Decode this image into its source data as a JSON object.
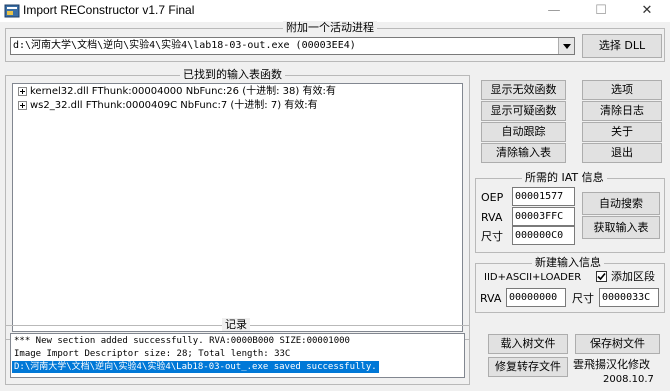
{
  "window": {
    "title": "Import REConstructor v1.7 Final",
    "minimize_glyph": "—",
    "maximize_glyph": "☐",
    "close_glyph": "✕"
  },
  "process": {
    "group_title": "附加一个活动进程",
    "selected": "d:\\河南大学\\文档\\逆向\\实验4\\实验4\\lab18-03-out.exe (00003EE4)",
    "select_dll_label": "选择 DLL"
  },
  "imports": {
    "group_title": "已找到的输入表函数",
    "rows": [
      "kernel32.dll FThunk:00004000 NbFunc:26 (十进制: 38) 有效:有",
      "ws2_32.dll FThunk:0000409C NbFunc:7 (十进制: 7) 有效:有"
    ]
  },
  "actions": {
    "show_invalid": "显示无效函数",
    "show_suspect": "显示可疑函数",
    "auto_trace": "自动跟踪",
    "clear_imports": "清除输入表",
    "options": "选项",
    "clear_log": "清除日志",
    "about": "关于",
    "exit": "退出"
  },
  "iat": {
    "group_title": "所需的 IAT 信息",
    "oep_label": "OEP",
    "oep_value": "00001577",
    "rva_label": "RVA",
    "rva_value": "00003FFC",
    "size_label": "尺寸",
    "size_value": "000000C0",
    "auto_search": "自动搜索",
    "get_imports": "获取输入表"
  },
  "new_import": {
    "group_title": "新建输入信息",
    "mode_label": "IID+ASCII+LOADER",
    "add_section_label": "添加区段",
    "add_section_checked": true,
    "rva_label": "RVA",
    "rva_value": "00000000",
    "size_label": "尺寸",
    "size_value": "0000033C"
  },
  "log": {
    "group_title": "记录",
    "lines": [
      "*** New section added successfully. RVA:0000B000 SIZE:00001000",
      "Image Import Descriptor size: 28; Total length: 33C",
      "D:\\河南大学\\文档\\逆向\\实验4\\实验4\\Lab18-03-out_.exe saved successfully."
    ]
  },
  "bottom": {
    "load_tree": "载入树文件",
    "save_tree": "保存树文件",
    "fix_dump": "修复转存文件",
    "credit": "雲飛揚汉化修改",
    "date": "2008.10.7"
  },
  "colors": {
    "selection": "#0078d7",
    "background": "#f0f0f0"
  }
}
